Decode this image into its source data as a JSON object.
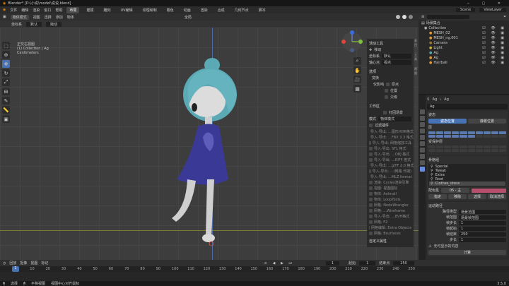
{
  "title_bar": {
    "text": "Blender* [D:\\小说\\model\\说说.blend]"
  },
  "top_menu": [
    "文件",
    "编辑",
    "渲染",
    "窗口",
    "帮助"
  ],
  "workspaces": [
    "布局",
    "建模",
    "雕刻",
    "UV编辑",
    "纹理绘制",
    "着色",
    "动画",
    "渲染",
    "合成",
    "几何节点",
    "脚本"
  ],
  "active_workspace": "布局",
  "scene": "Scene",
  "view_layer": "ViewLayer",
  "viewport": {
    "mode": "物体模式",
    "menus": [
      "视图",
      "选择",
      "添加",
      "物体"
    ],
    "orientation": "全局",
    "transform": "默认",
    "snap": "拖动",
    "overlay_lines": [
      "正交右视图",
      "(1) Collection | Ag",
      "Centimeters"
    ]
  },
  "npanel": {
    "active_tool_header": "活动工具",
    "active_tool": "移动",
    "orientation_label": "坐标系",
    "orientation_value": "默认",
    "pivot_label": "轴心点",
    "pivot_value": "视点",
    "options_header": "选项",
    "transform_label": "变换",
    "affect_label": "仅影响",
    "affect_opts": [
      "原点",
      "位置",
      "父级"
    ],
    "workspace_header": "工作区",
    "pin_label": "钉固场景",
    "mode_label": "模式",
    "mode_value": "物体模式",
    "addons_header": "过滤插件",
    "addons": [
      "导入-导出: ...图形HDR格式",
      "导入-导出: ...FBX 3.3 格式",
      "导入-导出: 网格缩放工具",
      "导入-导出: STL 格式",
      "导入-导出: ...OBJ 格式",
      "导入-导出: ...RIFF 格式",
      "导入-导出: ...glTF 2.0 格式",
      "导入-导出: ...(网格 日期)",
      "导入-导出: ...MLZ format",
      "渲染: Cycles渲染引擎",
      "视图: 视图图标",
      "物体: Animall",
      "物体: LoopTools",
      "网格: NodeWrangler",
      "网格: ...Wireframe",
      "导入-导出: ...BVH格式",
      "网格: F2",
      "网格编辑: Extra Objects",
      "网格: Bsurfaces"
    ],
    "custom_header": "自定义属性"
  },
  "outliner": {
    "header": "场景集合",
    "rows": [
      {
        "label": "Collection",
        "icon": "collection-icon",
        "indent": 0
      },
      {
        "label": "MESH_02",
        "icon": "mesh-icon",
        "indent": 1
      },
      {
        "label": "MESH_ng.001",
        "icon": "mesh-icon",
        "indent": 1
      },
      {
        "label": "Camera",
        "icon": "camera-icon",
        "indent": 1
      },
      {
        "label": "Light",
        "icon": "light-icon",
        "indent": 1
      },
      {
        "label": "Ag",
        "icon": "armature-icon",
        "indent": 1
      },
      {
        "label": "Ag",
        "icon": "mesh-icon",
        "indent": 1
      },
      {
        "label": "Hairball",
        "icon": "mesh-icon",
        "indent": 1
      }
    ]
  },
  "properties": {
    "object": "Ag",
    "data": "Ag",
    "name_field": "Ag",
    "pose_header": "姿态",
    "pose_btn": "姿态位置",
    "rest_btn": "静置位置",
    "layers_label": "层",
    "protect_label": "受保护层",
    "groups_header": "骨骼组",
    "groups": [
      "Special",
      "Tweak",
      "Extra",
      "Root",
      "Clothes_dress"
    ],
    "color_label": "配色集",
    "color_value": "05 - 主",
    "color_hex": "#b6506d",
    "assign_btns": [
      "指定",
      "移除",
      "选择",
      "取消选择"
    ],
    "motion_header": "运动路径",
    "motion_rows": [
      {
        "label": "路径类型",
        "value": "场景范围"
      },
      {
        "label": "帧范围",
        "value": "场景帧范围"
      },
      {
        "label": "帧步长",
        "value": "1"
      },
      {
        "label": "帧起始",
        "value": "1"
      },
      {
        "label": "帧结束",
        "value": "250"
      },
      {
        "label": "步长",
        "value": "1"
      }
    ],
    "warn": "无可显示的内容",
    "calc_btn": "计算"
  },
  "timeline": {
    "menus": [
      "回放",
      "抠像",
      "视图",
      "标记"
    ],
    "current_frame": "1",
    "start_label": "起始",
    "start": "1",
    "end_label": "结束点",
    "end": "250",
    "ticks": [
      "1",
      "10",
      "20",
      "30",
      "40",
      "50",
      "60",
      "70",
      "80",
      "90",
      "100",
      "110",
      "120",
      "130",
      "140",
      "150",
      "160",
      "170",
      "180",
      "190",
      "200",
      "210",
      "220",
      "230",
      "240",
      "250"
    ]
  },
  "status": {
    "left": "选择",
    "mid": "平移视图",
    "right": "视图中心对齐鼠标",
    "version": "3.5.0"
  },
  "colors": {
    "accent": "#4772b3",
    "hair": "#5aa9b5",
    "dress": "#3a3a96",
    "skin": "#d2d2d2"
  }
}
